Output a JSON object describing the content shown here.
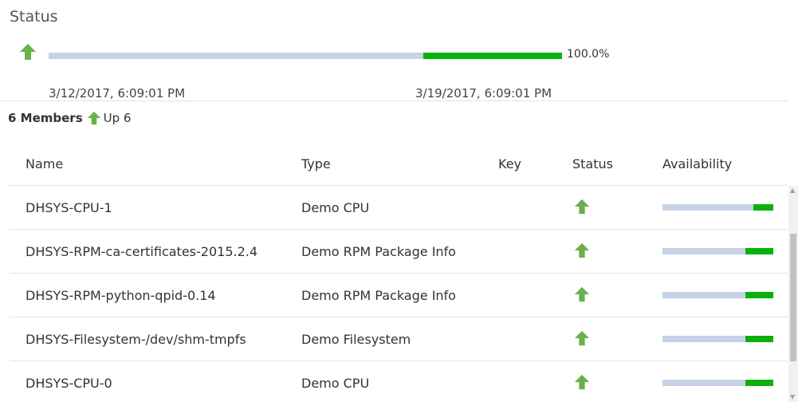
{
  "status": {
    "title": "Status",
    "icon": "arrow-up-icon",
    "availability_fraction": 0.27,
    "availability_label": "100.0%",
    "start_date": "3/12/2017, 6:09:01 PM",
    "end_date": "3/19/2017, 6:09:01 PM"
  },
  "members": {
    "count_label": "6 Members",
    "up_label": "Up 6"
  },
  "table": {
    "columns": [
      "Name",
      "Type",
      "Key",
      "Status",
      "Availability"
    ],
    "rows": [
      {
        "name": "DHSYS-CPU-1",
        "type": "Demo CPU",
        "key": "",
        "status_icon": "arrow-up-icon",
        "availability_fraction": 0.18
      },
      {
        "name": "DHSYS-RPM-ca-certificates-2015.2.4",
        "type": "Demo RPM Package Info",
        "key": "",
        "status_icon": "arrow-up-icon",
        "availability_fraction": 0.25
      },
      {
        "name": "DHSYS-RPM-python-qpid-0.14",
        "type": "Demo RPM Package Info",
        "key": "",
        "status_icon": "arrow-up-icon",
        "availability_fraction": 0.25
      },
      {
        "name": "DHSYS-Filesystem-/dev/shm-tmpfs",
        "type": "Demo Filesystem",
        "key": "",
        "status_icon": "arrow-up-icon",
        "availability_fraction": 0.25
      },
      {
        "name": "DHSYS-CPU-0",
        "type": "Demo CPU",
        "key": "",
        "status_icon": "arrow-up-icon",
        "availability_fraction": 0.25
      }
    ]
  },
  "colors": {
    "up_green": "#6ab04c",
    "bar_green": "#0bb00b",
    "bar_track": "#c6d2e6"
  }
}
